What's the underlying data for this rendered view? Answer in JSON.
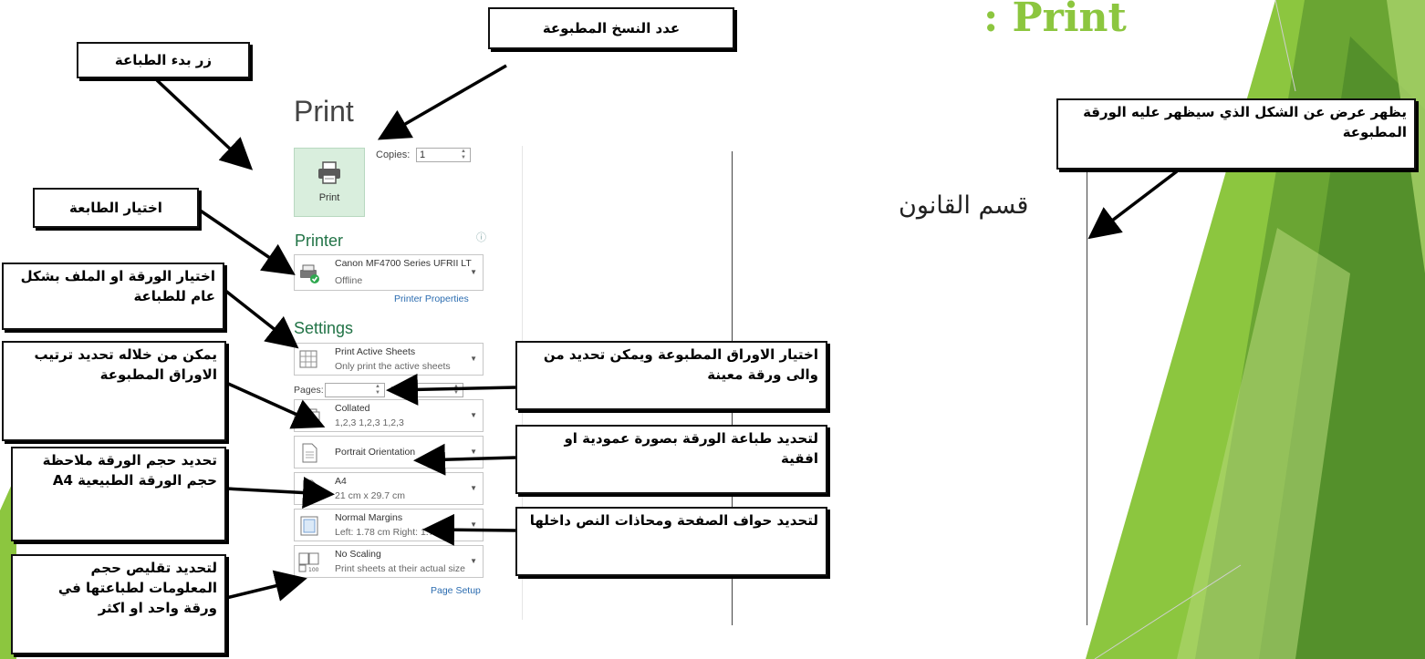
{
  "slide": {
    "title": ": Print",
    "accent_color": "#8cc63f",
    "theme_colors": [
      "#6aa533",
      "#8cc63f",
      "#b7d97a",
      "#4e8a2a"
    ]
  },
  "print_panel": {
    "heading": "Print",
    "print_button_label": "Print",
    "copies_label": "Copies:",
    "copies_value": "1",
    "printer_section": "Printer",
    "printer_name": "Canon MF4700 Series UFRII LT",
    "printer_status": "Offline",
    "printer_properties_link": "Printer Properties",
    "settings_section": "Settings",
    "active_sheets": {
      "title": "Print Active Sheets",
      "subtitle": "Only print the active sheets"
    },
    "pages_label": "Pages:",
    "pages_to": "to",
    "collated": {
      "title": "Collated",
      "subtitle": "1,2,3   1,2,3   1,2,3"
    },
    "orientation": {
      "title": "Portrait Orientation"
    },
    "paper_size": {
      "title": "A4",
      "subtitle": "21 cm x 29.7 cm"
    },
    "margins": {
      "title": "Normal Margins",
      "subtitle": "Left: 1.78 cm   Right: 1.78 cm"
    },
    "scaling": {
      "title": "No Scaling",
      "subtitle": "Print sheets at their actual size"
    },
    "page_setup_link": "Page Setup",
    "icons": {
      "printer": "printer-icon",
      "sheets": "sheets-icon",
      "collated": "collated-pages-icon",
      "orientation": "portrait-page-icon",
      "paper": "paper-size-icon",
      "margins": "margins-icon",
      "scaling": "scaling-icon",
      "info": "info-icon"
    }
  },
  "preview": {
    "text": "قسم القانون"
  },
  "callouts": {
    "copies": "عدد النسخ المطبوعة",
    "start_print": "زر بدء الطباعة",
    "choose_printer": "اختيار الطابعة",
    "choose_sheet": "اختيار الورقة او الملف بشكل عام للطباعة",
    "order": "يمكن من خلاله تحديد ترتيب الاوراق المطبوعة",
    "size": "تحديد حجم الورقة ملاحظة حجم الورقة الطبيعية A4",
    "scaling": "لتحديد تقليص حجم المعلومات لطباعتها في ورقة واحد او اكثر",
    "preview": "يظهر عرض عن الشكل الذي سيظهر عليه الورقة المطبوعة",
    "pages": "اختيار الاوراق المطبوعة ويمكن تحديد من والى ورقة معينة",
    "orientation": "لتحديد طباعة الورقة بصورة عمودية او افقية",
    "margins": "لتحديد حواف الصفحة ومحاذات النص داخلها"
  }
}
